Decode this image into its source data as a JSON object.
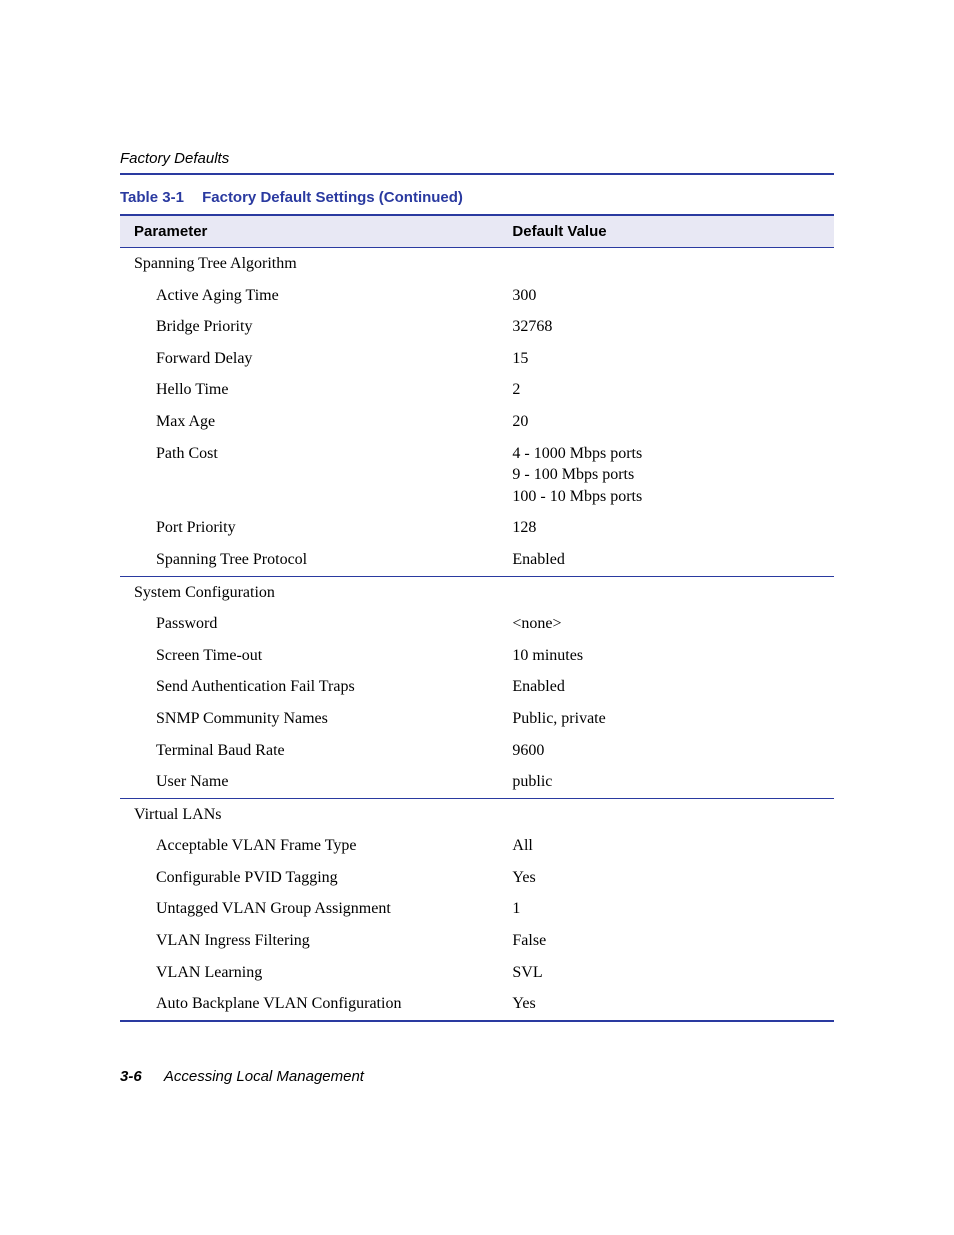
{
  "header": {
    "running_title": "Factory Defaults"
  },
  "table": {
    "number": "Table 3-1",
    "title": "Factory Default Settings (Continued)",
    "col_parameter": "Parameter",
    "col_value": "Default Value",
    "sections": [
      {
        "name": "Spanning Tree Algorithm",
        "rows": [
          {
            "param": "Active Aging Time",
            "value": "300"
          },
          {
            "param": "Bridge Priority",
            "value": "32768"
          },
          {
            "param": "Forward Delay",
            "value": "15"
          },
          {
            "param": "Hello Time",
            "value": "2"
          },
          {
            "param": "Max Age",
            "value": "20"
          },
          {
            "param": "Path Cost",
            "value": "4 - 1000 Mbps ports\n9 - 100 Mbps ports\n100 - 10 Mbps ports"
          },
          {
            "param": "Port Priority",
            "value": "128"
          },
          {
            "param": "Spanning Tree Protocol",
            "value": "Enabled"
          }
        ]
      },
      {
        "name": "System Configuration",
        "rows": [
          {
            "param": "Password",
            "value": "<none>"
          },
          {
            "param": "Screen Time-out",
            "value": "10 minutes"
          },
          {
            "param": "Send Authentication Fail Traps",
            "value": "Enabled"
          },
          {
            "param": "SNMP Community Names",
            "value": "Public, private"
          },
          {
            "param": "Terminal Baud Rate",
            "value": "9600"
          },
          {
            "param": "User Name",
            "value": "public"
          }
        ]
      },
      {
        "name": "Virtual LANs",
        "rows": [
          {
            "param": "Acceptable VLAN Frame Type",
            "value": "All"
          },
          {
            "param": "Configurable PVID Tagging",
            "value": "Yes"
          },
          {
            "param": "Untagged VLAN Group Assignment",
            "value": "1"
          },
          {
            "param": "VLAN Ingress Filtering",
            "value": "False"
          },
          {
            "param": "VLAN Learning",
            "value": "SVL"
          },
          {
            "param": "Auto Backplane VLAN Configuration",
            "value": "Yes"
          }
        ]
      }
    ]
  },
  "footer": {
    "page": "3-6",
    "chapter": "Accessing Local Management"
  }
}
